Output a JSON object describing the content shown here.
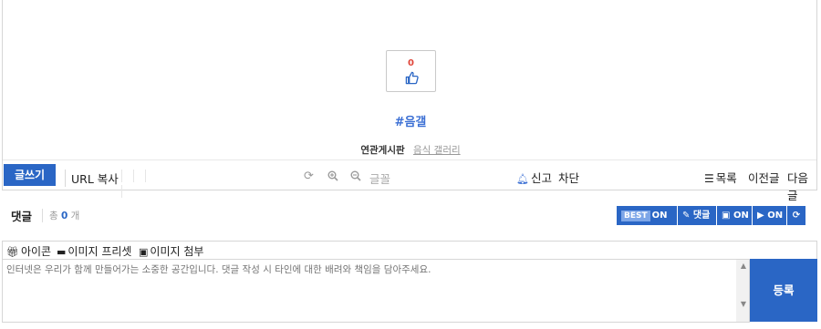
{
  "post": {
    "like_count": "0",
    "tag": "#음갤",
    "related_label": "연관게시판",
    "related_link": "음식 갤러리"
  },
  "toolbar": {
    "write": "글쓰기",
    "url_copy": "URL 복사",
    "font": "글꼴",
    "report": "신고",
    "block": "차단",
    "list": "목록",
    "prev": "이전글",
    "next": "다음글"
  },
  "comments": {
    "title": "댓글",
    "total_prefix": "총",
    "total_count": "0",
    "total_suffix": "개",
    "buttons": {
      "best": "BEST",
      "best_state": "ON",
      "comment": "댓글",
      "image_state": "ON",
      "video_state": "ON"
    }
  },
  "form": {
    "icon": "아이콘",
    "image_preset": "이미지 프리셋",
    "image_attach": "이미지 첨부",
    "placeholder": "인터넷은 우리가 함께 만들어가는 소중한 공간입니다. 댓글 작성 시 타인에 대한 배려와 책임을 담아주세요.",
    "submit": "등록"
  },
  "colors": {
    "accent": "#2a66c5",
    "like_count": "#e0463a",
    "tag": "#3b6fd4"
  }
}
